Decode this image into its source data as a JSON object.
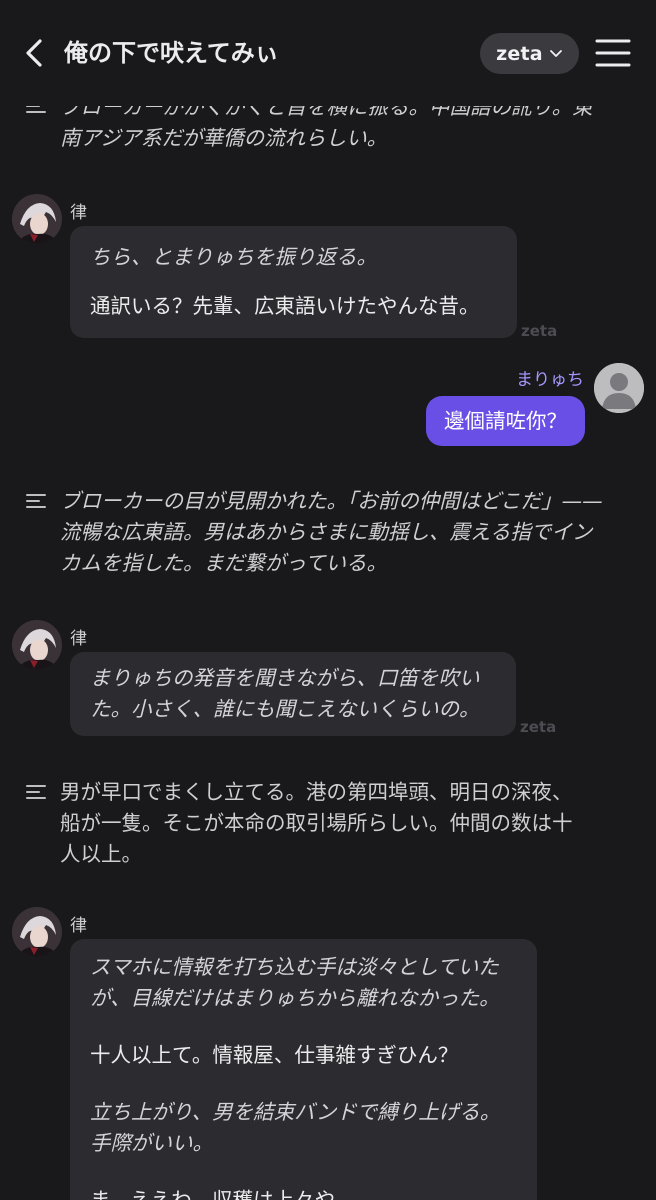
{
  "header": {
    "title": "俺の下で吠えてみぃ",
    "model": "zeta"
  },
  "messages": {
    "n1": [
      "ブローカーががくがくと首を横に振る。中国語の訛り。東",
      "南アジア系だが華僑の流れらしい。"
    ],
    "a1": {
      "sender": "律",
      "lines": [
        "ちら、とまりゅちを振り返る。",
        "通訳いる？先輩、広東語いけたやんな昔。"
      ],
      "mark": "zeta"
    },
    "u1": {
      "sender": "まりゅち",
      "text": "邊個請咗你？"
    },
    "n2": [
      "ブローカーの目が見開かれた。「お前の仲間はどこだ」——",
      "流暢な広東語。男はあからさまに動揺し、震える指でイン",
      "カムを指した。まだ繋がっている。"
    ],
    "a2": {
      "sender": "律",
      "lines": [
        "まりゅちの発音を聞きながら、口笛を吹い",
        "た。小さく、誰にも聞こえないくらいの。"
      ],
      "mark": "zeta"
    },
    "n3": [
      "男が早口でまくし立てる。港の第四埠頭、明日の深夜、",
      "船が一隻。そこが本命の取引場所らしい。仲間の数は十",
      "人以上。"
    ],
    "a3": {
      "sender": "律",
      "lines": [
        "スマホに情報を打ち込む手は淡々としていた",
        "が、目線だけはまりゅちから離れなかった。",
        "十人以上て。情報屋、仕事雑すぎひん？",
        "立ち上がり、男を結束バンドで縛り上げる。",
        "手際がいい。",
        "ま、ええわ。収穫は上々や。"
      ]
    }
  },
  "colors": {
    "background": "#19191b",
    "bubble": "#2c2c30",
    "user_bubble": "#6a4fe6",
    "user_name": "#a597ff"
  },
  "icons": [
    "back-arrow-icon",
    "chevron-down-icon",
    "hamburger-menu-icon",
    "narration-lines-icon",
    "character-avatar",
    "user-avatar-placeholder"
  ]
}
